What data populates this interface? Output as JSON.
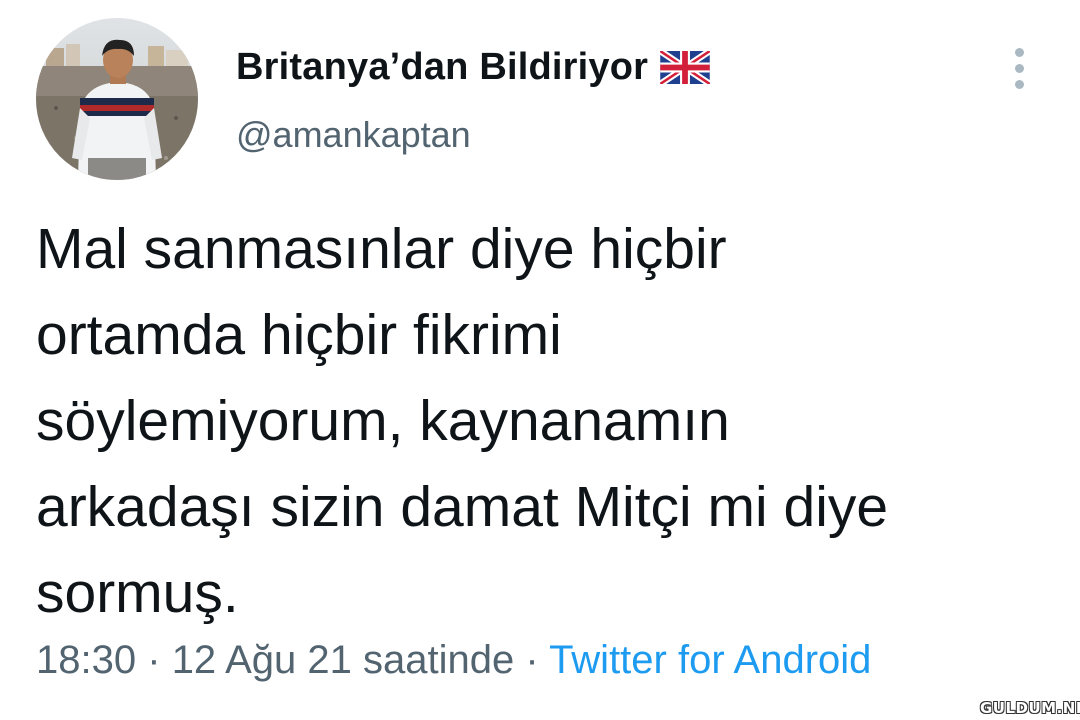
{
  "tweet": {
    "author": {
      "display_name": "Britanya’dan Bildiriyor",
      "handle": "@amankaptan",
      "flag": "uk-flag-icon"
    },
    "menu_icon": "more-vertical-icon",
    "text_lines": [
      "Mal sanmasınlar diye hiçbir",
      "ortamda hiçbir fikrimi",
      "söylemiyorum, kaynanamın",
      "arkadaşı sizin damat Mitçi mi diye",
      "sormuş."
    ],
    "time": "18:30",
    "separator": "·",
    "date": "12 Ağu 21 saatinde",
    "source": "Twitter for Android"
  },
  "watermark": "GULDUM.NET",
  "colors": {
    "text": "#0f1419",
    "secondary": "#536471",
    "link": "#1d9bf0"
  }
}
